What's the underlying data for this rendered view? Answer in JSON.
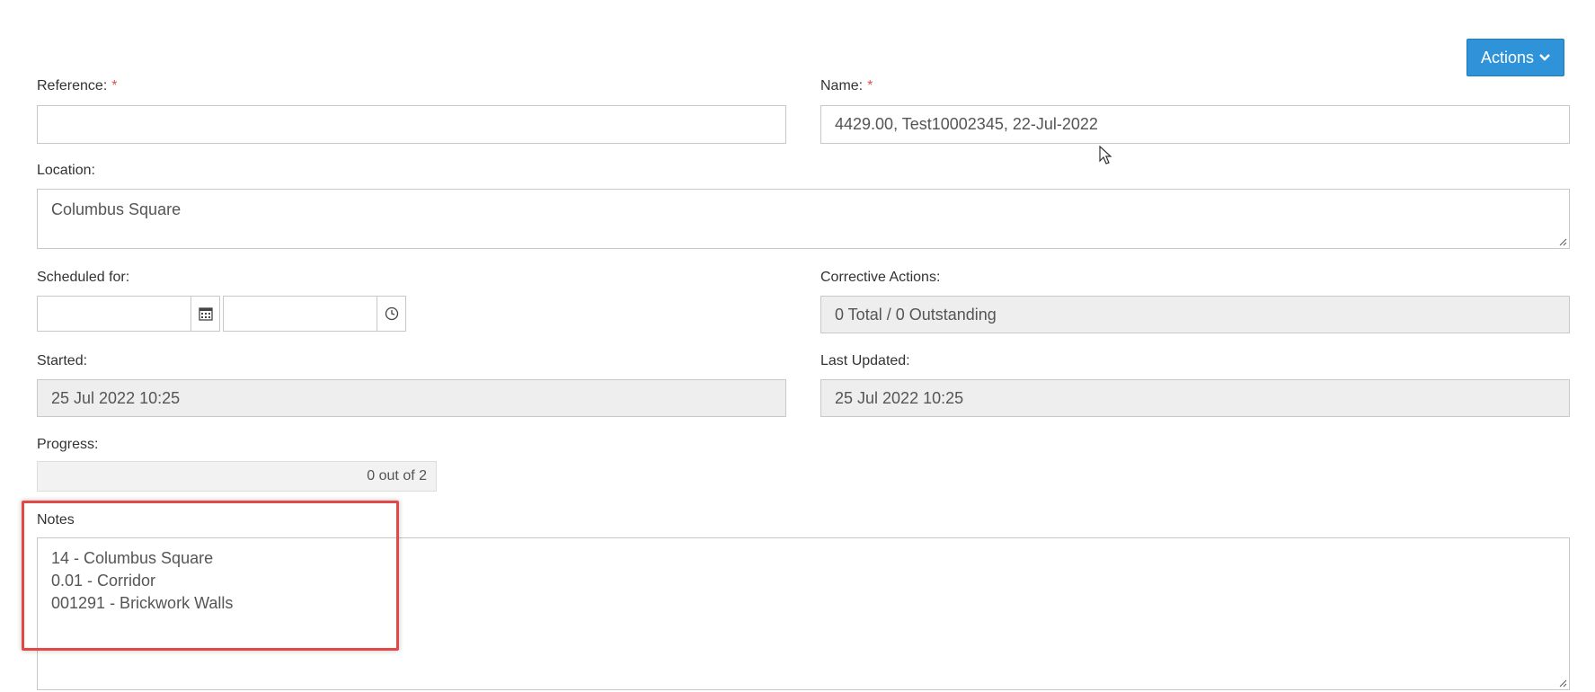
{
  "header": {
    "actions_label": "Actions"
  },
  "form": {
    "reference": {
      "label": "Reference:",
      "required_mark": "*",
      "value": ""
    },
    "name": {
      "label": "Name:",
      "required_mark": "*",
      "value": "4429.00, Test10002345, 22-Jul-2022"
    },
    "location": {
      "label": "Location:",
      "value": "Columbus Square"
    },
    "scheduled_for": {
      "label": "Scheduled for:",
      "date_value": "",
      "time_value": ""
    },
    "corrective_actions": {
      "label": "Corrective Actions:",
      "value": "0 Total / 0 Outstanding"
    },
    "started": {
      "label": "Started:",
      "value": "25 Jul 2022 10:25"
    },
    "last_updated": {
      "label": "Last Updated:",
      "value": "25 Jul 2022 10:25"
    },
    "progress": {
      "label": "Progress:",
      "value": "0 out of 2"
    },
    "notes": {
      "label": "Notes",
      "lines": [
        "14 - Columbus Square",
        "0.01 - Corridor",
        "001291 - Brickwork Walls"
      ]
    }
  },
  "colors": {
    "accent": "#2f93d9",
    "highlight": "#e34848",
    "required": "#d9534f",
    "readonly_bg": "#eeeeee"
  },
  "icons": [
    "chevron-down-icon",
    "calendar-icon",
    "clock-icon",
    "resize-grip-icon",
    "mouse-cursor-icon"
  ]
}
